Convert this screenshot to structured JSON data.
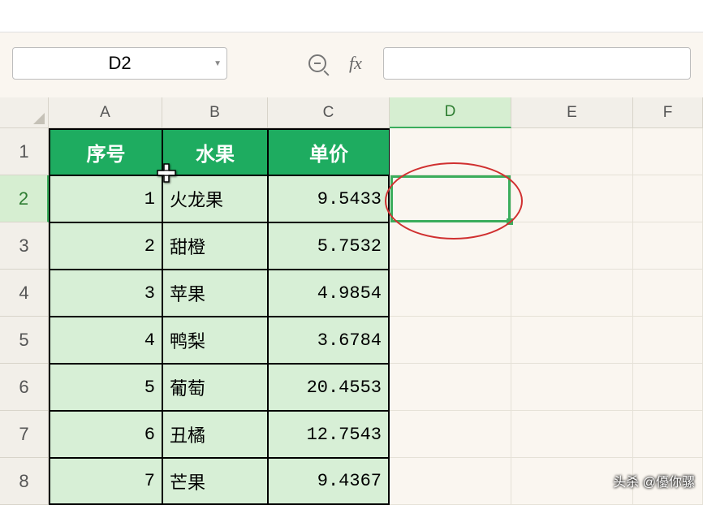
{
  "name_box": "D2",
  "fx_label": "fx",
  "formula_value": "",
  "columns": [
    "A",
    "B",
    "C",
    "D",
    "E",
    "F"
  ],
  "selected_col": "D",
  "selected_row": 2,
  "headers": {
    "a": "序号",
    "b": "水果",
    "c": "单价"
  },
  "rows": [
    {
      "seq": "1",
      "fruit": "火龙果",
      "price": "9.5433"
    },
    {
      "seq": "2",
      "fruit": "甜橙",
      "price": "5.7532"
    },
    {
      "seq": "3",
      "fruit": "苹果",
      "price": "4.9854"
    },
    {
      "seq": "4",
      "fruit": "鸭梨",
      "price": "3.6784"
    },
    {
      "seq": "5",
      "fruit": "葡萄",
      "price": "20.4553"
    },
    {
      "seq": "6",
      "fruit": "丑橘",
      "price": "12.7543"
    },
    {
      "seq": "7",
      "fruit": "芒果",
      "price": "9.4367"
    }
  ],
  "watermark": "头杀 @優你骡"
}
